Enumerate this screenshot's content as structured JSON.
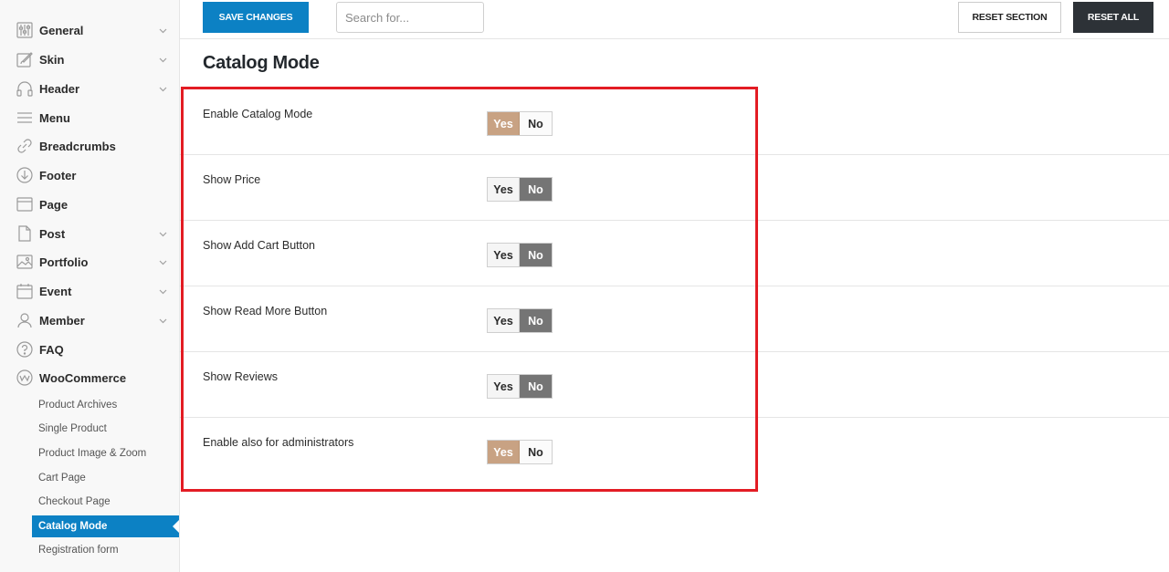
{
  "toolbar": {
    "save_label": "SAVE CHANGES",
    "search_placeholder": "Search for...",
    "reset_section_label": "RESET SECTION",
    "reset_all_label": "RESET ALL"
  },
  "sidebar": {
    "items": [
      {
        "label": "General",
        "icon": "sliders-icon",
        "has_chevron": true
      },
      {
        "label": "Skin",
        "icon": "paint-brush-icon",
        "has_chevron": true
      },
      {
        "label": "Header",
        "icon": "headphones-icon",
        "has_chevron": true
      },
      {
        "label": "Menu",
        "icon": "menu-lines-icon",
        "has_chevron": false
      },
      {
        "label": "Breadcrumbs",
        "icon": "link-icon",
        "has_chevron": false
      },
      {
        "label": "Footer",
        "icon": "arrow-down-circle-icon",
        "has_chevron": false
      },
      {
        "label": "Page",
        "icon": "browser-window-icon",
        "has_chevron": false
      },
      {
        "label": "Post",
        "icon": "document-icon",
        "has_chevron": true
      },
      {
        "label": "Portfolio",
        "icon": "image-icon",
        "has_chevron": true
      },
      {
        "label": "Event",
        "icon": "calendar-icon",
        "has_chevron": true
      },
      {
        "label": "Member",
        "icon": "user-icon",
        "has_chevron": true
      },
      {
        "label": "FAQ",
        "icon": "question-circle-icon",
        "has_chevron": false
      },
      {
        "label": "WooCommerce",
        "icon": "woocommerce-icon",
        "has_chevron": false
      }
    ],
    "subitems": [
      {
        "label": "Product Archives",
        "active": false
      },
      {
        "label": "Single Product",
        "active": false
      },
      {
        "label": "Product Image & Zoom",
        "active": false
      },
      {
        "label": "Cart Page",
        "active": false
      },
      {
        "label": "Checkout Page",
        "active": false
      },
      {
        "label": "Catalog Mode",
        "active": true
      },
      {
        "label": "Registration form",
        "active": false
      }
    ]
  },
  "main": {
    "title": "Catalog Mode",
    "yes_label": "Yes",
    "no_label": "No",
    "options": [
      {
        "label": "Enable Catalog Mode",
        "value": "Yes"
      },
      {
        "label": "Show Price",
        "value": "No"
      },
      {
        "label": "Show Add Cart Button",
        "value": "No"
      },
      {
        "label": "Show Read More Button",
        "value": "No"
      },
      {
        "label": "Show Reviews",
        "value": "No"
      },
      {
        "label": "Enable also for administrators",
        "value": "Yes"
      }
    ]
  },
  "colors": {
    "primary": "#0c81c4",
    "yes_active": "#c8a283",
    "no_active": "#757575",
    "highlight_border": "#e31c24",
    "dark_button": "#2d3237"
  }
}
